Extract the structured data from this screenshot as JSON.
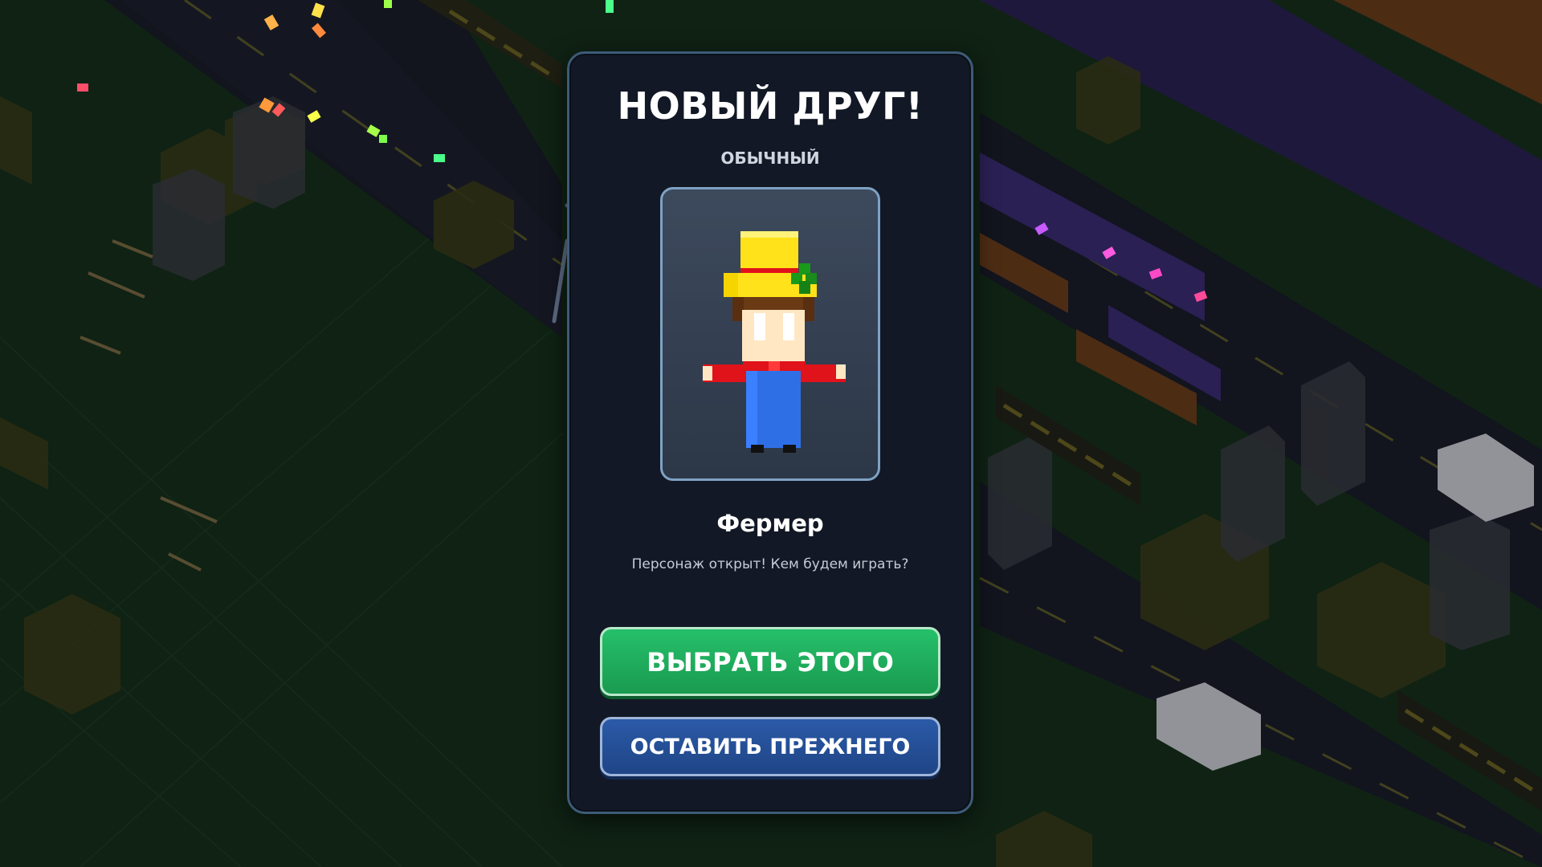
{
  "modal": {
    "title": "НОВЫЙ ДРУГ!",
    "rarity": "ОБЫЧНЫЙ",
    "character_name": "Фермер",
    "description": "Персонаж открыт! Кем будем играть?",
    "buttons": {
      "select_label": "ВЫБРАТЬ ЭТОГО",
      "keep_label": "ОСТАВИТЬ ПРЕЖНЕГО"
    }
  },
  "colors": {
    "select_button": "#1fae5c",
    "keep_button": "#26509a",
    "modal_background": "#121825",
    "modal_border": "#3d5b78",
    "portrait_border": "#7fa2c4"
  },
  "icons": {
    "character": "farmer-voxel-character",
    "confetti": "confetti-particles"
  }
}
